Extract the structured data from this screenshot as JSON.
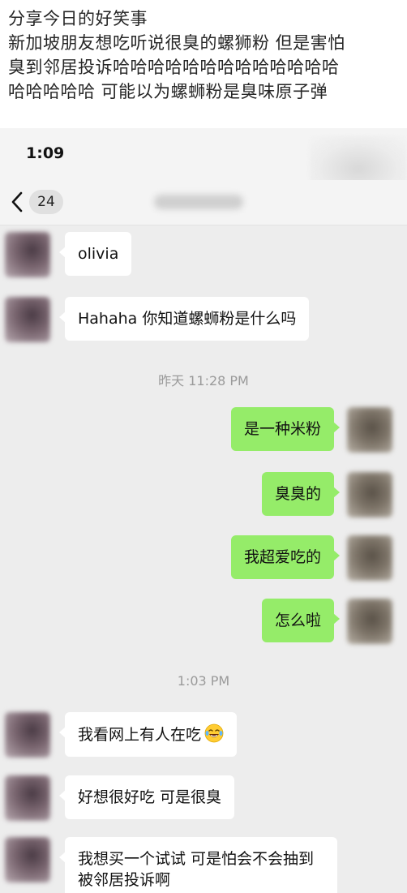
{
  "caption": {
    "lines": [
      "分享今日的好笑事",
      "新加坡朋友想吃听说很臭的螺狮粉 但是害怕",
      "臭到邻居投诉哈哈哈哈哈哈哈哈哈哈哈哈哈",
      "哈哈哈哈哈 可能以为螺蛳粉是臭味原子弹"
    ]
  },
  "status_bar": {
    "time": "1:09"
  },
  "nav": {
    "unread_count": "24",
    "back_icon": "chevron-left-icon"
  },
  "messages": [
    {
      "side": "in",
      "text": "olivia"
    },
    {
      "side": "in",
      "text": "Hahaha 你知道螺蛳粉是什么吗"
    },
    {
      "timestamp": "昨天 11:28 PM"
    },
    {
      "side": "out",
      "text": "是一种米粉"
    },
    {
      "side": "out",
      "text": "臭臭的"
    },
    {
      "side": "out",
      "text": "我超爱吃的"
    },
    {
      "side": "out",
      "text": "怎么啦"
    },
    {
      "timestamp": "1:03 PM"
    },
    {
      "side": "in",
      "text": "我看网上有人在吃",
      "emoji": "laughing-tears-emoji"
    },
    {
      "side": "in",
      "text": "好想很好吃 可是很臭"
    },
    {
      "side": "in",
      "text": "我想买一个试试 可是怕会不会抽到被邻居投诉啊"
    }
  ],
  "colors": {
    "chat_background": "#ededed",
    "outgoing_bubble": "#95ec69",
    "incoming_bubble": "#ffffff",
    "timestamp_text": "#9a9a9a"
  }
}
